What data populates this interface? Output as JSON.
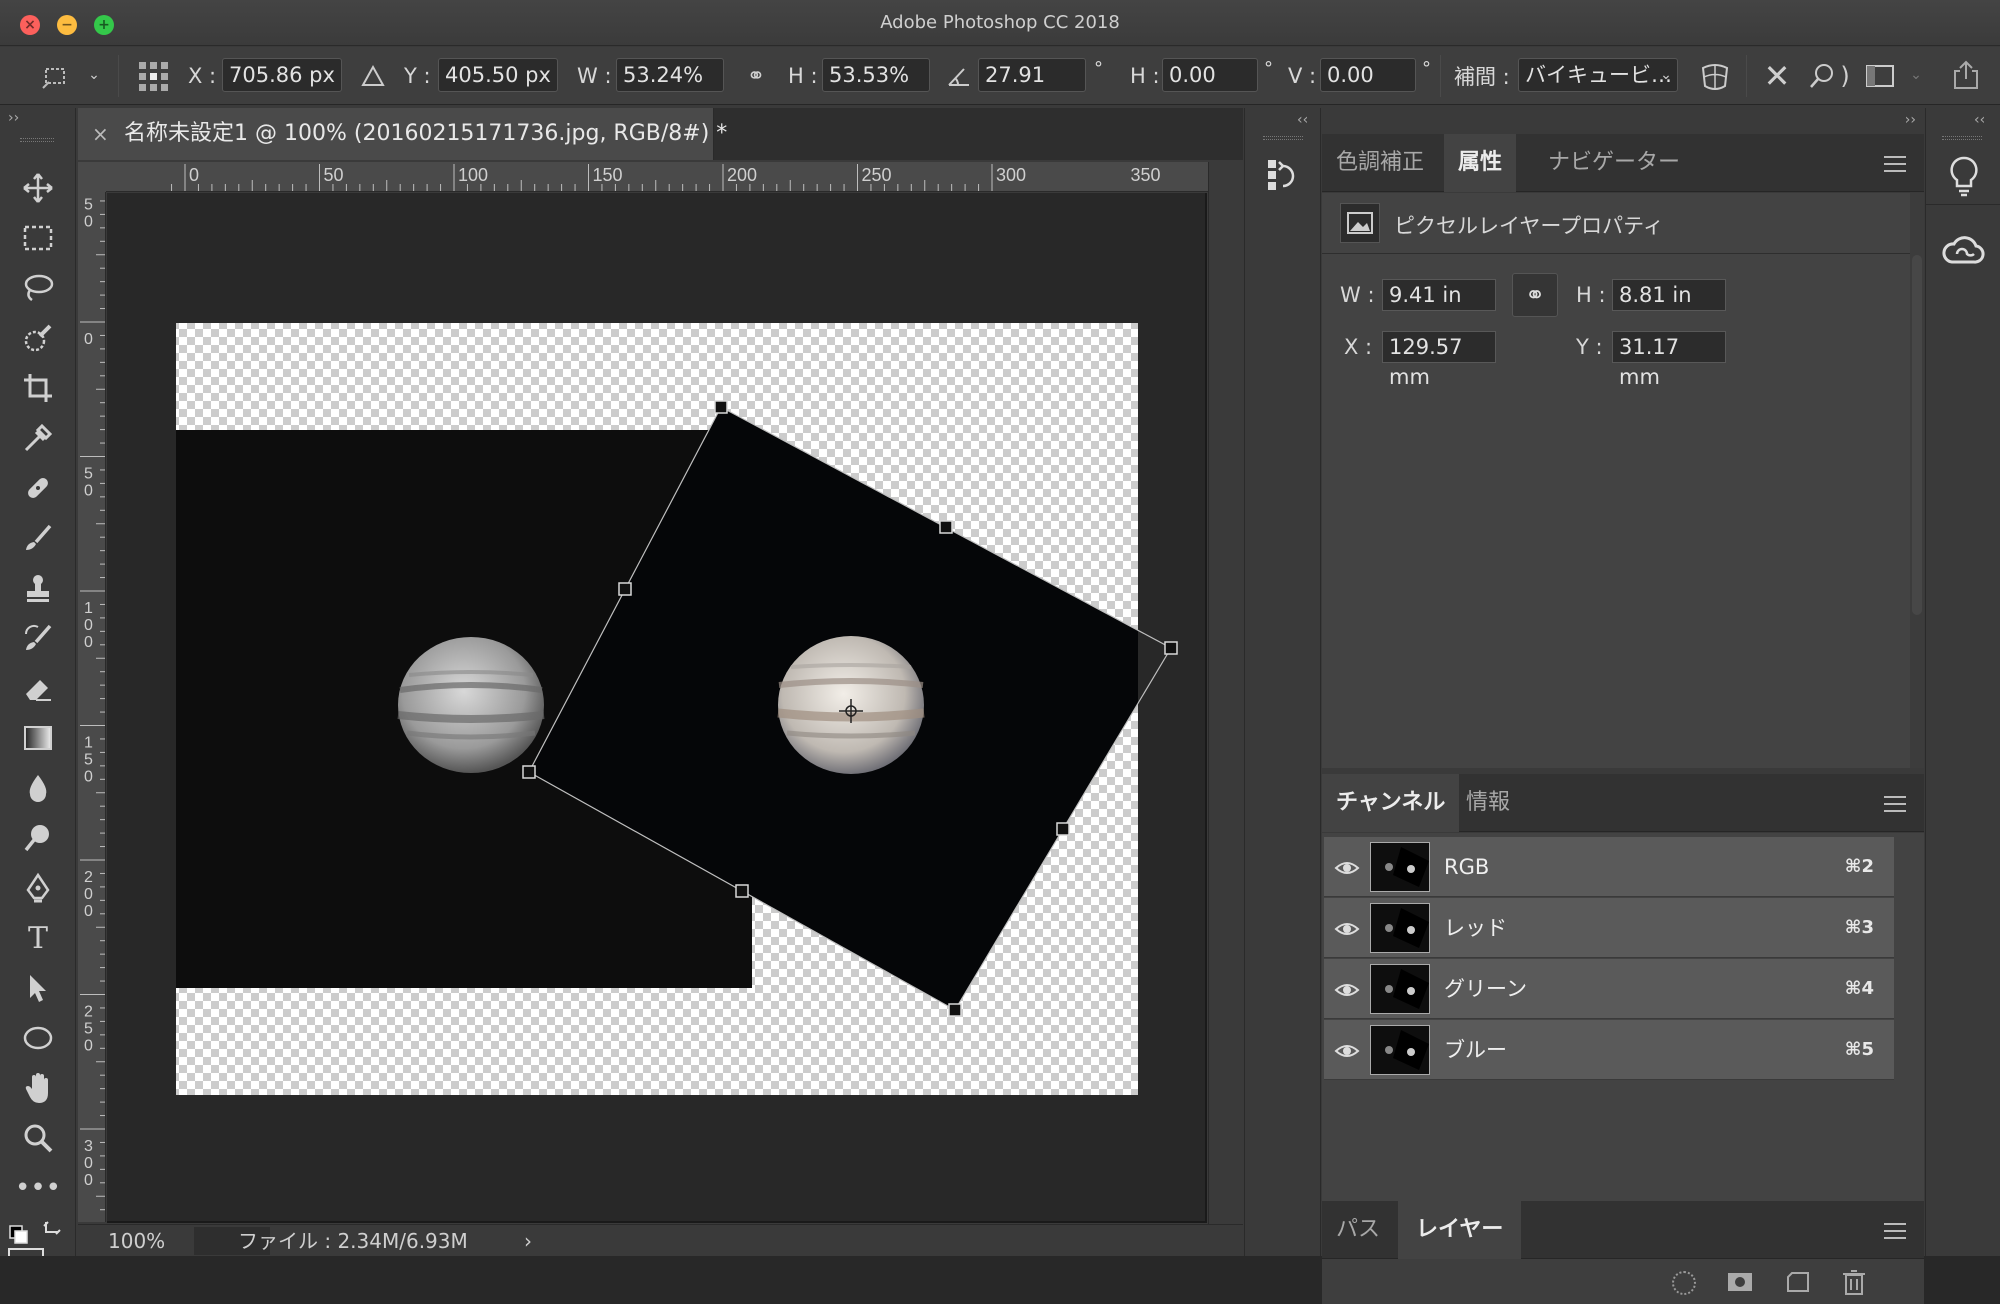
{
  "window": {
    "title": "Adobe Photoshop CC 2018"
  },
  "options": {
    "x_label": "X :",
    "x_value": "705.86 px",
    "y_label": "Y :",
    "y_value": "405.50 px",
    "w_label": "W :",
    "w_value": "53.24%",
    "h_label": "H :",
    "h_value": "53.53%",
    "angle_value": "27.91",
    "deg": "°",
    "skew_h_label": "H :",
    "skew_h_value": "0.00",
    "skew_v_label": "V :",
    "skew_v_value": "0.00",
    "interp_label": "補間 :",
    "interp_value": "バイキュービ…"
  },
  "document": {
    "tab_title": "名称未設定1 @ 100% (20160215171736.jpg, RGB/8#) *",
    "zoom": "100%",
    "file_info": "ファイル : 2.34M/6.93M",
    "ruler_h": [
      "0",
      "50",
      "100",
      "150",
      "200",
      "250",
      "300",
      "350"
    ],
    "ruler_v": [
      "5\n0",
      "0",
      "5\n0",
      "1\n0\n0",
      "1\n5\n0",
      "2\n0\n0",
      "2\n5\n0",
      "3\n0\n0"
    ]
  },
  "properties_panel": {
    "tabs": [
      "色調補正",
      "属性",
      "ナビゲーター"
    ],
    "active_tab": "属性",
    "header": "ピクセルレイヤープロパティ",
    "w_label": "W :",
    "w_value": "9.41 in",
    "h_label": "H :",
    "h_value": "8.81 in",
    "x_label": "X :",
    "x_value": "129.57 mm",
    "y_label": "Y :",
    "y_value": "31.17 mm"
  },
  "channels_panel": {
    "tabs": [
      "チャンネル",
      "情報"
    ],
    "active_tab": "チャンネル",
    "channels": [
      {
        "name": "RGB",
        "shortcut": "⌘2"
      },
      {
        "name": "レッド",
        "shortcut": "⌘3"
      },
      {
        "name": "グリーン",
        "shortcut": "⌘4"
      },
      {
        "name": "ブルー",
        "shortcut": "⌘5"
      }
    ]
  },
  "bottom_panel": {
    "tabs": [
      "パス",
      "レイヤー"
    ],
    "active_tab": "レイヤー"
  },
  "colors": {
    "accent_panel_bg": "#3a3a3a",
    "canvas_bg": "#282828",
    "checker_light": "#ffffff",
    "checker_dark": "#cccccc"
  }
}
